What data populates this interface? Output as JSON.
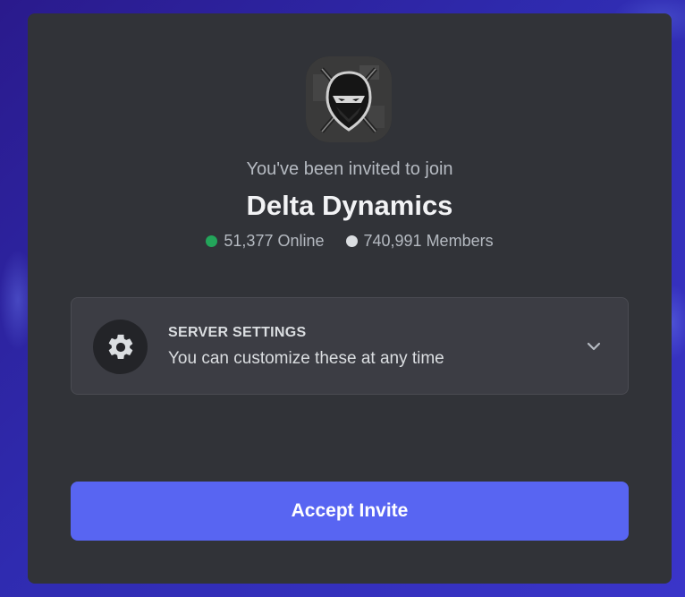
{
  "invite": {
    "intro_text": "You've been invited to join",
    "server_name": "Delta Dynamics",
    "online_count": "51,377 Online",
    "member_count": "740,991 Members",
    "server_icon": "ninja-logo-icon"
  },
  "settings": {
    "title": "SERVER SETTINGS",
    "subtitle": "You can customize these at any time",
    "icon": "gear-icon",
    "toggle_icon": "chevron-down-icon"
  },
  "actions": {
    "accept_label": "Accept Invite"
  },
  "colors": {
    "accent": "#5865f2",
    "online": "#23a55a",
    "card_bg": "#313338"
  }
}
